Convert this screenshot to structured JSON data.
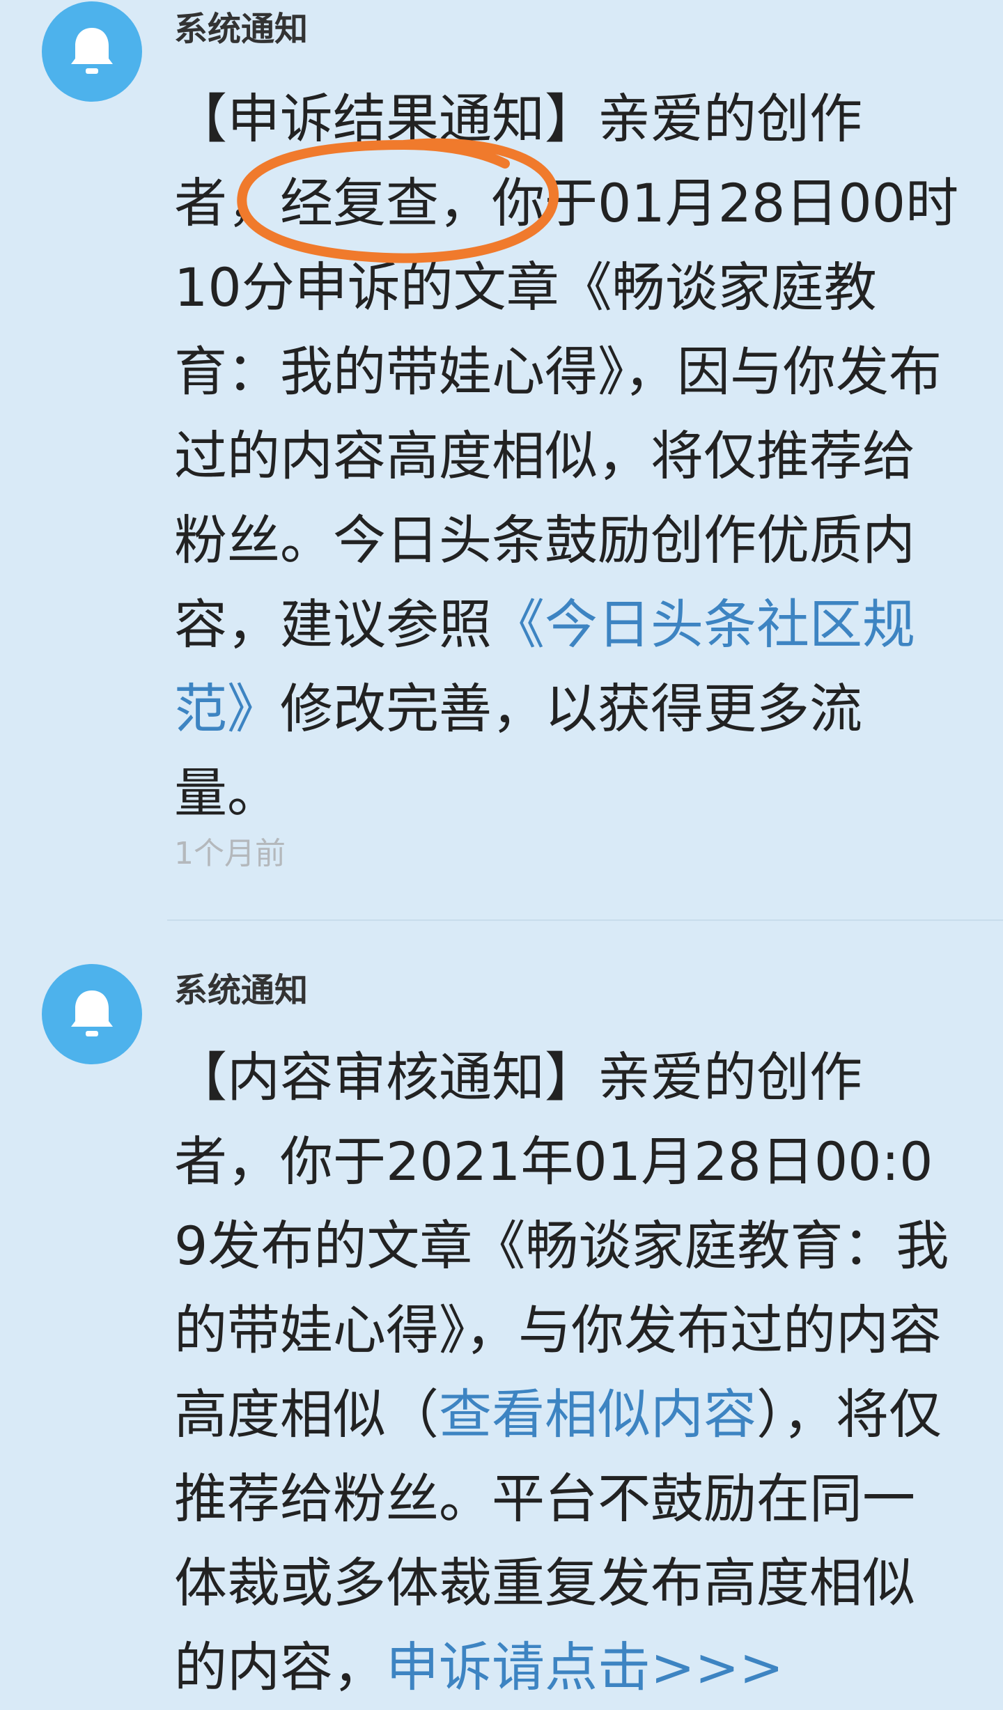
{
  "colors": {
    "background": "#d9eaf7",
    "avatar": "#4db2ec",
    "link": "#3d84c2",
    "time": "#b4b8bc",
    "annotation": "#f07a2c"
  },
  "icons": {
    "avatar": "bell-icon"
  },
  "messages": [
    {
      "sender": "系统通知",
      "text_1": "【申诉结果通知】亲爱的创作者，经复查，你于01月28日00时10分申诉的文章《畅谈家庭教育：我的带娃心得》，因与你发布过的内容高度相似，将仅推荐给粉丝。今日头条鼓励创作优质内容，建议参照",
      "link": "《今日头条社区规范》",
      "text_2": "修改完善，以获得更多流量。",
      "time": "1个月前"
    },
    {
      "sender": "系统通知",
      "text_1": "【内容审核通知】亲爱的创作者，你于2021年01月28日00:09发布的文章《畅谈家庭教育：我的带娃心得》，与你发布过的内容高度相似（",
      "link": "查看相似内容",
      "text_2": "），将仅推荐给粉丝。平台不鼓励在同一体裁或多体裁重复发布高度相似的内容，",
      "link_2": "申诉请点击>>>"
    }
  ]
}
